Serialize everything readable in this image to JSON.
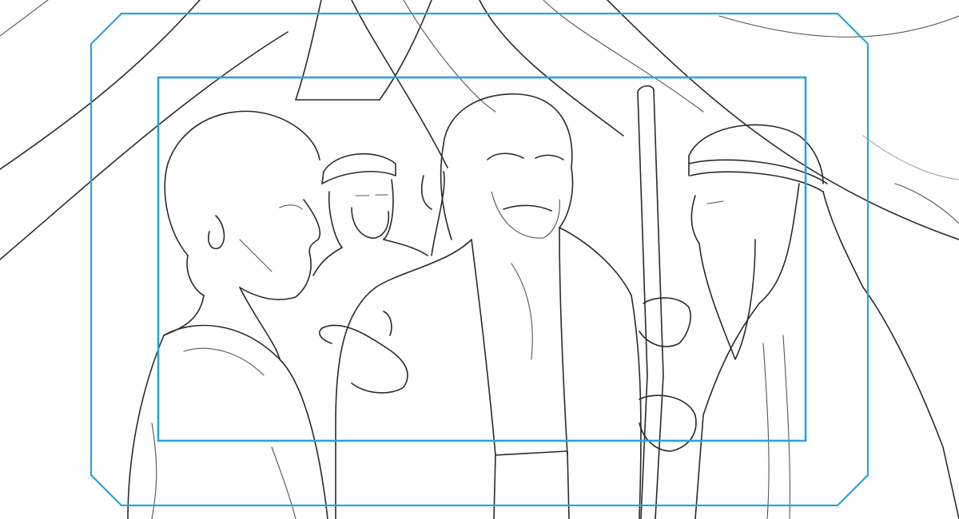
{
  "canvas": {
    "background": "#ffffff",
    "ink_color": "#2a2a2a"
  },
  "guides": {
    "color": "#29a3e0",
    "outer_frame": "action-safe",
    "inner_frame": "title-safe"
  },
  "scene": {
    "figures": [
      {
        "name": "figure-left-man"
      },
      {
        "name": "figure-headband-man-back"
      },
      {
        "name": "figure-center-man"
      },
      {
        "name": "figure-elder-with-staff"
      }
    ]
  }
}
